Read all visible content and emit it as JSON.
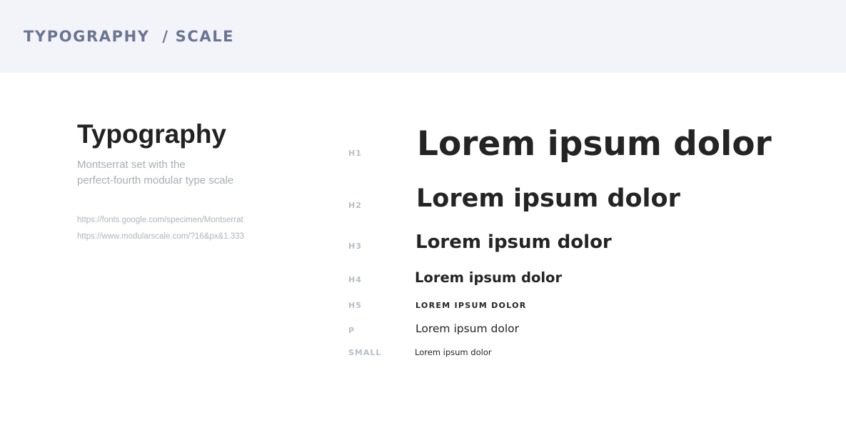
{
  "header": {
    "title": "TYPOGRAPHY  / SCALE"
  },
  "intro": {
    "title": "Typography",
    "description_lines": [
      "Montserrat set with the",
      "perfect-fourth modular type scale"
    ],
    "links": [
      "https://fonts.google.com/specimen/Montserrat",
      "https://www.modularscale.com/?16&px&1.333"
    ]
  },
  "scale": [
    {
      "label": "H1",
      "sample": "Lorem ipsum dolor"
    },
    {
      "label": "H2",
      "sample": "Lorem ipsum dolor"
    },
    {
      "label": "H3",
      "sample": "Lorem ipsum dolor"
    },
    {
      "label": "H4",
      "sample": "Lorem ipsum dolor"
    },
    {
      "label": "H5",
      "sample": "LOREM IPSUM DOLOR"
    },
    {
      "label": "P",
      "sample": "Lorem ipsum dolor"
    },
    {
      "label": "SMALL",
      "sample": "Lorem ipsum dolor"
    }
  ],
  "colors": {
    "header_bg": "#f3f4f9",
    "header_text": "#6b7593",
    "heading_text": "#242424",
    "muted_text": "#a9adb5",
    "label_text": "#b9bdc4"
  }
}
